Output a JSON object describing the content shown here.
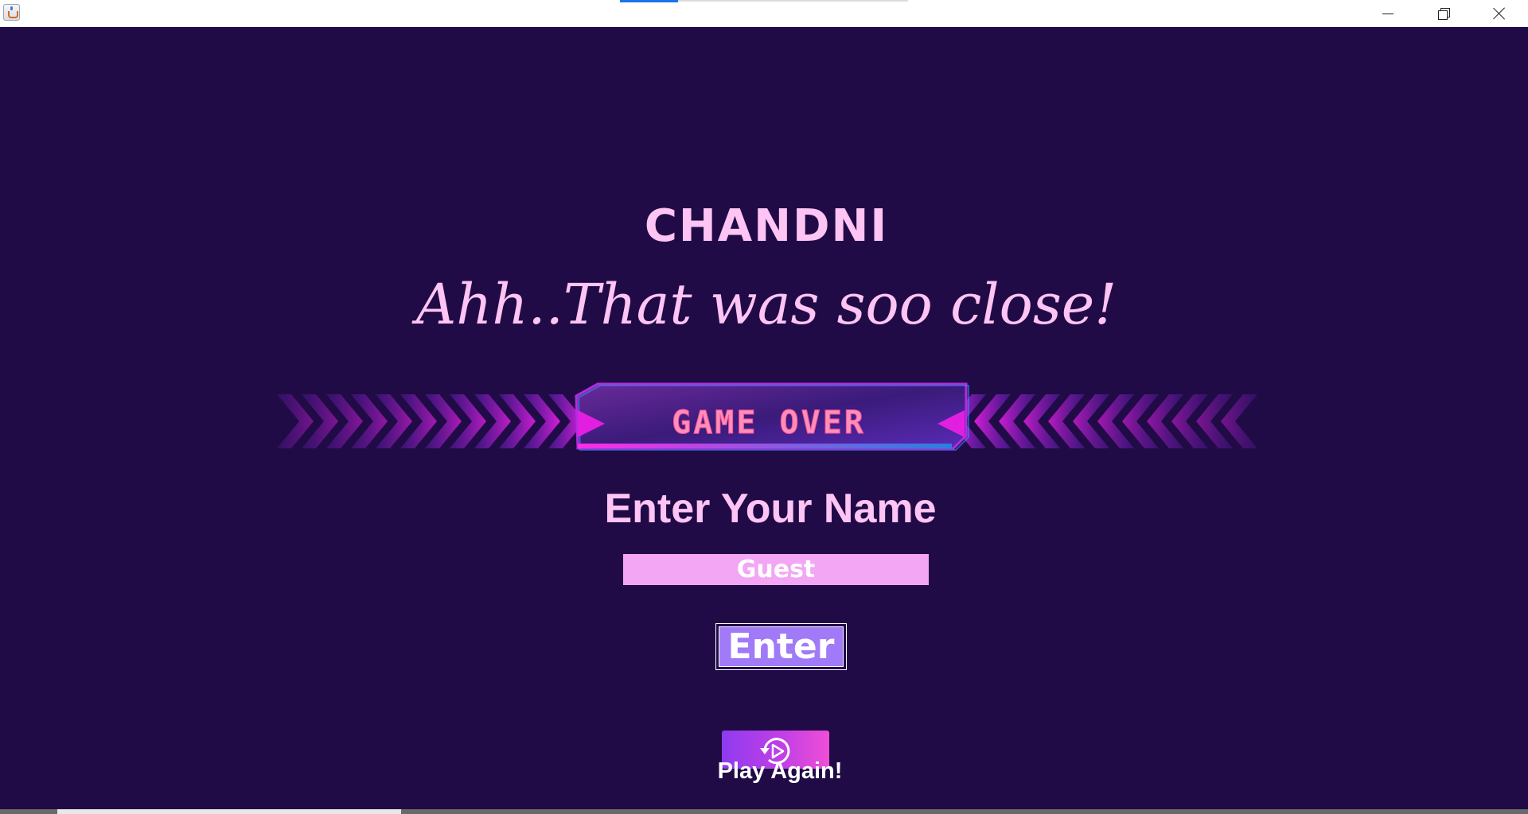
{
  "window": {
    "title": "",
    "controls": {
      "minimize": "minimize",
      "maximize": "restore",
      "close": "close"
    }
  },
  "game_over_screen": {
    "player_name": "CHANDNI",
    "message": "Ahh..That was soo close!",
    "banner_text": "GAME OVER",
    "name_prompt": "Enter Your Name",
    "name_input_value": "Guest",
    "enter_button_label": "Enter",
    "play_again_label": "Play Again!"
  },
  "colors": {
    "background": "#210b47",
    "text_pink": "#fdc4f4",
    "input_bg": "#f2a6f3",
    "enter_button": "#a07af7",
    "banner_magenta": "#d61ce0",
    "banner_blue": "#2b7fe0"
  },
  "icons": {
    "app": "java-cup-icon",
    "play_again": "replay-icon"
  }
}
